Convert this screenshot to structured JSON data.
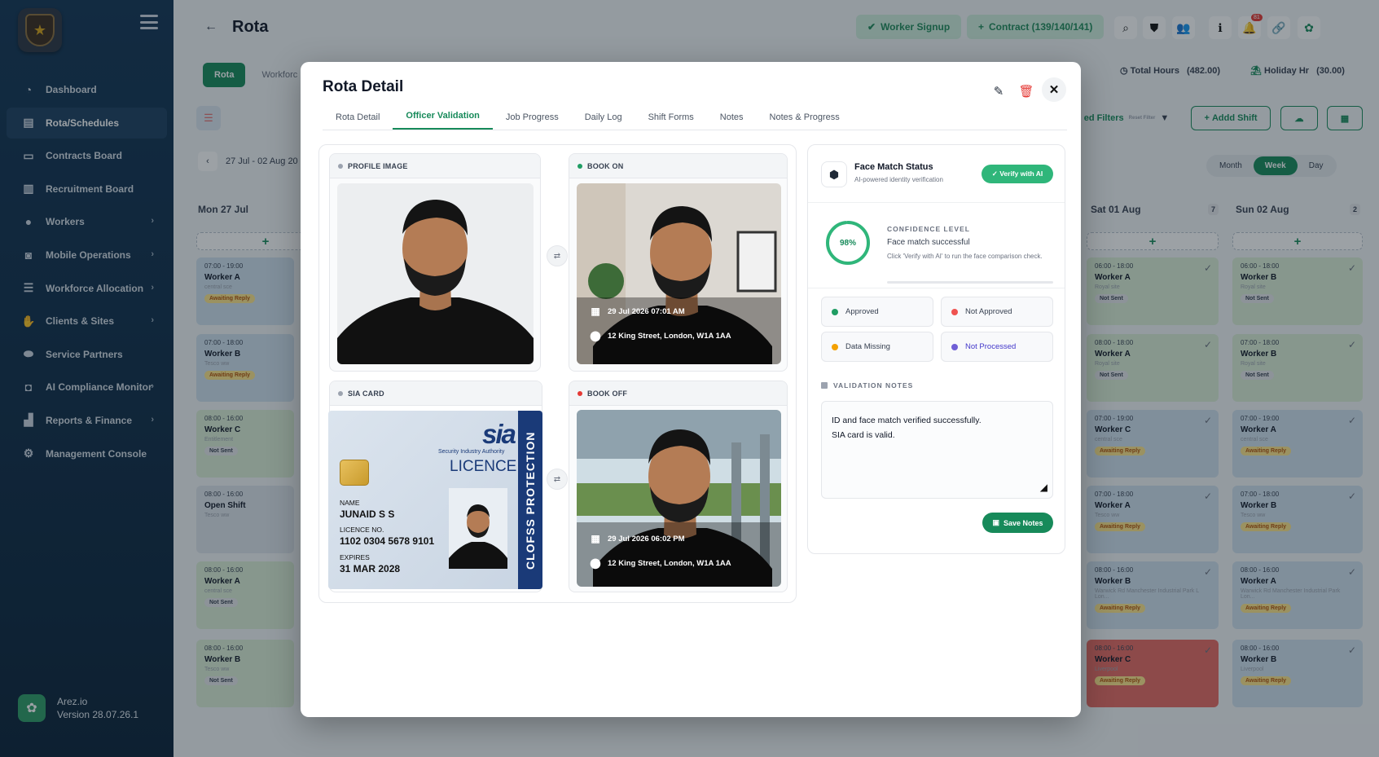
{
  "sidebar": {
    "brand_name": "Arez.io",
    "version": "Version 28.07.26.1",
    "items": [
      {
        "label": "Dashboard",
        "icon": "gauge-icon",
        "has_children": false
      },
      {
        "label": "Rota/Schedules",
        "icon": "clipboard-icon",
        "has_children": false
      },
      {
        "label": "Contracts Board",
        "icon": "contract-icon",
        "has_children": false
      },
      {
        "label": "Recruitment Board",
        "icon": "clipboard-user-icon",
        "has_children": false
      },
      {
        "label": "Workers",
        "icon": "user-icon",
        "has_children": true
      },
      {
        "label": "Mobile Operations",
        "icon": "car-icon",
        "has_children": true
      },
      {
        "label": "Workforce Allocation",
        "icon": "list-icon",
        "has_children": true
      },
      {
        "label": "Clients & Sites",
        "icon": "handshake-icon",
        "has_children": true
      },
      {
        "label": "Service Partners",
        "icon": "partners-icon",
        "has_children": false
      },
      {
        "label": "AI Compliance Monitor",
        "icon": "robot-icon",
        "has_children": true
      },
      {
        "label": "Reports & Finance",
        "icon": "chart-icon",
        "has_children": true
      },
      {
        "label": "Management Console",
        "icon": "gears-icon",
        "has_children": false
      }
    ]
  },
  "header": {
    "title": "Rota",
    "worker_signup": "Worker Signup",
    "contract": "Contract (139/140/141)",
    "notification_count": "81"
  },
  "background": {
    "tab_rota": "Rota",
    "tab_workforce": "Workforc",
    "total_hours_label": "Total Hours",
    "total_hours_value": "(482.00)",
    "holiday_label": "Holiday Hr",
    "holiday_value": "(30.00)",
    "filters_label": "ed Filters",
    "reset_filter": "Reset Filter",
    "add_shift": "Addd Shift",
    "date_range": "27 Jul - 02 Aug 20",
    "view_tabs": [
      "Month",
      "Week",
      "Day"
    ],
    "days": [
      {
        "label": "Mon 27 Jul",
        "count": ""
      },
      {
        "label": "Sat 01 Aug",
        "count": "7"
      },
      {
        "label": "Sun 02 Aug",
        "count": "2"
      }
    ],
    "mon_shifts": [
      {
        "time": "07:00 - 19:00",
        "name": "Worker A",
        "site": "central sce",
        "badge": "Awaiting Reply",
        "tone": "blue"
      },
      {
        "time": "07:00 - 18:00",
        "name": "Worker B",
        "site": "Tesco ww",
        "badge": "Awaiting Reply",
        "tone": "blue"
      },
      {
        "time": "08:00 - 16:00",
        "name": "Worker C",
        "site": "Entitlement",
        "badge": "Not Sent",
        "tone": "green"
      },
      {
        "time": "08:00 - 16:00",
        "name": "Open Shift",
        "site": "Tesco ww",
        "badge": "",
        "tone": "grey"
      },
      {
        "time": "08:00 - 16:00",
        "name": "Worker A",
        "site": "central sce",
        "badge": "Not Sent",
        "tone": "green"
      },
      {
        "time": "08:00 - 16:00",
        "name": "Worker B",
        "site": "Tesco ww",
        "badge": "Not Sent",
        "tone": "green"
      }
    ],
    "sat_shifts": [
      {
        "time": "06:00 - 18:00",
        "name": "Worker A",
        "site": "Royal site",
        "badge": "Not Sent",
        "tone": "green"
      },
      {
        "time": "08:00 - 18:00",
        "name": "Worker A",
        "site": "Royal site",
        "badge": "Not Sent",
        "tone": "green"
      },
      {
        "time": "07:00 - 19:00",
        "name": "Worker C",
        "site": "central sce",
        "badge": "Awaiting Reply",
        "tone": "blue"
      },
      {
        "time": "07:00 - 18:00",
        "name": "Worker A",
        "site": "Tesco ww",
        "badge": "Awaiting Reply",
        "tone": "blue"
      },
      {
        "time": "08:00 - 16:00",
        "name": "Worker B",
        "site": "Warwick Rd Manchester Industrial Park L Lon...",
        "badge": "Awaiting Reply",
        "tone": "blue"
      },
      {
        "time": "08:00 - 16:00",
        "name": "Worker C",
        "site": "Liverpool",
        "badge": "Awaiting Reply",
        "tone": "red"
      }
    ],
    "sun_shifts": [
      {
        "time": "06:00 - 18:00",
        "name": "Worker B",
        "site": "Royal site",
        "badge": "Not Sent",
        "tone": "green"
      },
      {
        "time": "07:00 - 18:00",
        "name": "Worker B",
        "site": "Royal site",
        "badge": "Not Sent",
        "tone": "green"
      },
      {
        "time": "07:00 - 19:00",
        "name": "Worker A",
        "site": "central sce",
        "badge": "Awaiting Reply",
        "tone": "blue"
      },
      {
        "time": "07:00 - 18:00",
        "name": "Worker B",
        "site": "Tesco ww",
        "badge": "Awaiting Reply",
        "tone": "blue"
      },
      {
        "time": "08:00 - 16:00",
        "name": "Worker A",
        "site": "Warwick Rd Manchester Industrial Park Lon...",
        "badge": "Awaiting Reply",
        "tone": "blue"
      },
      {
        "time": "08:00 - 16:00",
        "name": "Worker B",
        "site": "Liverpool",
        "badge": "Awaiting Reply",
        "tone": "blue"
      }
    ]
  },
  "modal": {
    "title": "Rota Detail",
    "tabs": [
      "Rota Detail",
      "Officer Validation",
      "Job Progress",
      "Daily Log",
      "Shift Forms",
      "Notes",
      "Notes & Progress"
    ],
    "active_tab": "Officer Validation",
    "profile_image_label": "PROFILE IMAGE",
    "book_on_label": "BOOK ON",
    "book_on_datetime": "29 Jul 2026   07:01 AM",
    "book_on_location": "12 King Street, London, W1A 1AA",
    "sia_card_label": "SIA CARD",
    "book_off_label": "BOOK OFF",
    "book_off_datetime": "29 Jul 2026   06:02 PM",
    "book_off_location": "12 King Street, London, W1A 1AA",
    "sia": {
      "logo": "sia",
      "authority": "Security Industry Authority",
      "licence_word": "LICENCE",
      "band": "CLOFSS PROTECTION",
      "name_label": "NAME",
      "name": "JUNAID S S",
      "licence_no_label": "LICENCE NO.",
      "licence_no": "1102 0304 5678 9101",
      "expires_label": "EXPIRES",
      "expires": "31 MAR 2028"
    },
    "face_match": {
      "title": "Face Match Status",
      "subtitle": "AI-powered identity verification",
      "verify_button": "✓ Verify with AI",
      "confidence_label": "CONFIDENCE LEVEL",
      "confidence_pct": "98%",
      "confidence_value": 0.98,
      "result": "Face match successful",
      "hint": "Click 'Verify with AI' to run the face comparison check."
    },
    "statuses": [
      {
        "label": "Approved",
        "color": "#1f9d63"
      },
      {
        "label": "Not Approved",
        "color": "#ef5350"
      },
      {
        "label": "Data Missing",
        "color": "#f4a100"
      },
      {
        "label": "Not Processed",
        "color": "#6f5fd6"
      }
    ],
    "validation_notes_label": "VALIDATION NOTES",
    "validation_notes_line1": "ID and face match verified successfully.",
    "validation_notes_line2": "SIA card is valid.",
    "save_notes": "Save Notes"
  },
  "colors": {
    "accent": "#178a5a",
    "sidebar": "#0f2c48"
  }
}
